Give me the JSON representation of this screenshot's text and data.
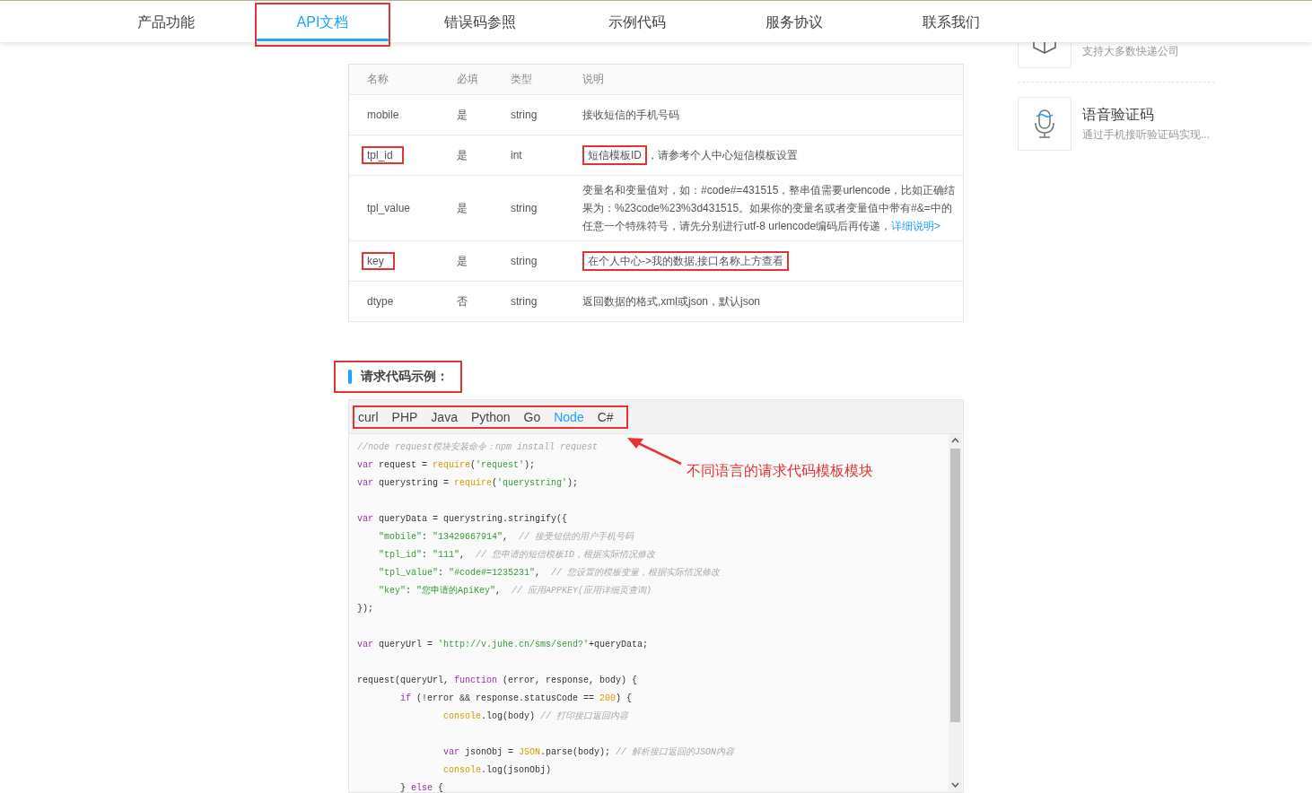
{
  "nav": [
    {
      "label": "产品功能",
      "selected": false,
      "marked": false
    },
    {
      "label": "API文档",
      "selected": true,
      "marked": true
    },
    {
      "label": "错误码参照",
      "selected": false,
      "marked": false
    },
    {
      "label": "示例代码",
      "selected": false,
      "marked": false
    },
    {
      "label": "服务协议",
      "selected": false,
      "marked": false
    },
    {
      "label": "联系我们",
      "selected": false,
      "marked": false
    }
  ],
  "params_table": {
    "columns": [
      "名称",
      "必填",
      "类型",
      "说明"
    ],
    "rows": [
      {
        "name": {
          "text": "mobile",
          "marked": false
        },
        "required": "是",
        "type": "string",
        "description": [
          {
            "kind": "text",
            "text": "接收短信的手机号码"
          }
        ]
      },
      {
        "name": {
          "text": "tpl_id",
          "marked": true
        },
        "required": "是",
        "type": "int",
        "description": [
          {
            "kind": "text",
            "text": "短信模板ID",
            "marked": true
          },
          {
            "kind": "text",
            "text": "，请参考个人中心短信模板设置"
          }
        ]
      },
      {
        "name": {
          "text": "tpl_value",
          "marked": false
        },
        "required": "是",
        "type": "string",
        "description": [
          {
            "kind": "text",
            "text": "变量名和变量值对，如：#code#=431515，整串值需要urlencode，比如正确结果为：%23code%23%3d431515。如果你的变量名或者变量值中带有#&=中的任意一个特殊符号，请先分别进行utf-8 urlencode编码后再传递，"
          },
          {
            "kind": "link",
            "text": "详细说明>"
          }
        ]
      },
      {
        "name": {
          "text": "key",
          "marked": true
        },
        "required": "是",
        "type": "string",
        "description": [
          {
            "kind": "text",
            "text": "在个人中心->我的数据,接口名称上方查看",
            "marked": true
          }
        ]
      },
      {
        "name": {
          "text": "dtype",
          "marked": false
        },
        "required": "否",
        "type": "string",
        "description": [
          {
            "kind": "text",
            "text": "返回数据的格式,xml或json，默认json"
          }
        ]
      }
    ]
  },
  "code_section": {
    "heading": "请求代码示例：",
    "heading_marked": true,
    "tabs_marked": true,
    "tabs": [
      {
        "label": "curl",
        "selected": false
      },
      {
        "label": "PHP",
        "selected": false
      },
      {
        "label": "Java",
        "selected": false
      },
      {
        "label": "Python",
        "selected": false
      },
      {
        "label": "Go",
        "selected": false
      },
      {
        "label": "Node",
        "selected": true
      },
      {
        "label": "C#",
        "selected": false
      }
    ],
    "annotation": "不同语言的请求代码模板模块",
    "lines": [
      {
        "kind": "code",
        "tokens": [
          {
            "kind": "comment",
            "text": "//node request模块安装命令：npm install request"
          }
        ]
      },
      {
        "kind": "code",
        "tokens": [
          {
            "kind": "keyword",
            "text": "var"
          },
          {
            "kind": "plain",
            "text": " request = "
          },
          {
            "kind": "builtin",
            "text": "require"
          },
          {
            "kind": "plain",
            "text": "("
          },
          {
            "kind": "string",
            "text": "'request'"
          },
          {
            "kind": "plain",
            "text": ");"
          }
        ]
      },
      {
        "kind": "code",
        "tokens": [
          {
            "kind": "keyword",
            "text": "var"
          },
          {
            "kind": "plain",
            "text": " querystring = "
          },
          {
            "kind": "builtin",
            "text": "require"
          },
          {
            "kind": "plain",
            "text": "("
          },
          {
            "kind": "string",
            "text": "'querystring'"
          },
          {
            "kind": "plain",
            "text": ");"
          }
        ]
      },
      {
        "kind": "blank"
      },
      {
        "kind": "code",
        "tokens": [
          {
            "kind": "keyword",
            "text": "var"
          },
          {
            "kind": "plain",
            "text": " queryData = querystring.stringify({"
          }
        ]
      },
      {
        "kind": "code",
        "tokens": [
          {
            "kind": "string",
            "text": "    \"mobile\""
          },
          {
            "kind": "plain",
            "text": ": "
          },
          {
            "kind": "string",
            "text": "\"13429667914\""
          },
          {
            "kind": "plain",
            "text": ",  "
          },
          {
            "kind": "comment",
            "text": "// 接受短信的用户手机号码"
          }
        ]
      },
      {
        "kind": "code",
        "tokens": [
          {
            "kind": "string",
            "text": "    \"tpl_id\""
          },
          {
            "kind": "plain",
            "text": ": "
          },
          {
            "kind": "string",
            "text": "\"111\""
          },
          {
            "kind": "plain",
            "text": ",  "
          },
          {
            "kind": "comment",
            "text": "// 您申请的短信模板ID，根据实际情况修改"
          }
        ]
      },
      {
        "kind": "code",
        "tokens": [
          {
            "kind": "string",
            "text": "    \"tpl_value\""
          },
          {
            "kind": "plain",
            "text": ": "
          },
          {
            "kind": "string",
            "text": "\"#code#=1235231\""
          },
          {
            "kind": "plain",
            "text": ",  "
          },
          {
            "kind": "comment",
            "text": "// 您设置的模板变量，根据实际情况修改"
          }
        ]
      },
      {
        "kind": "code",
        "tokens": [
          {
            "kind": "string",
            "text": "    \"key\""
          },
          {
            "kind": "plain",
            "text": ": "
          },
          {
            "kind": "string",
            "text": "\"您申请的ApiKey\""
          },
          {
            "kind": "plain",
            "text": ",  "
          },
          {
            "kind": "comment",
            "text": "// 应用APPKEY(应用详细页查询)"
          }
        ]
      },
      {
        "kind": "code",
        "tokens": [
          {
            "kind": "plain",
            "text": "});"
          }
        ]
      },
      {
        "kind": "blank"
      },
      {
        "kind": "code",
        "tokens": [
          {
            "kind": "keyword",
            "text": "var"
          },
          {
            "kind": "plain",
            "text": " queryUrl = "
          },
          {
            "kind": "string",
            "text": "'http://v.juhe.cn/sms/send?'"
          },
          {
            "kind": "plain",
            "text": "+queryData;"
          }
        ]
      },
      {
        "kind": "blank"
      },
      {
        "kind": "code",
        "tokens": [
          {
            "kind": "plain",
            "text": "request(queryUrl, "
          },
          {
            "kind": "keyword",
            "text": "function"
          },
          {
            "kind": "plain",
            "text": " (error, response, body) {"
          }
        ]
      },
      {
        "kind": "code",
        "tokens": [
          {
            "kind": "keyword",
            "text": "        if"
          },
          {
            "kind": "plain",
            "text": " (!error && response.statusCode == "
          },
          {
            "kind": "number",
            "text": "200"
          },
          {
            "kind": "plain",
            "text": ") {"
          }
        ]
      },
      {
        "kind": "code",
        "tokens": [
          {
            "kind": "builtin",
            "text": "                console"
          },
          {
            "kind": "plain",
            "text": ".log(body) "
          },
          {
            "kind": "comment",
            "text": "// 打印接口返回内容"
          }
        ]
      },
      {
        "kind": "blank"
      },
      {
        "kind": "code",
        "tokens": [
          {
            "kind": "keyword",
            "text": "                var"
          },
          {
            "kind": "plain",
            "text": " jsonObj = "
          },
          {
            "kind": "builtin",
            "text": "JSON"
          },
          {
            "kind": "plain",
            "text": ".parse(body); "
          },
          {
            "kind": "comment",
            "text": "// 解析接口返回的JSON内容"
          }
        ]
      },
      {
        "kind": "code",
        "tokens": [
          {
            "kind": "builtin",
            "text": "                console"
          },
          {
            "kind": "plain",
            "text": ".log(jsonObj)"
          }
        ]
      },
      {
        "kind": "code",
        "tokens": [
          {
            "kind": "plain",
            "text": "        } "
          },
          {
            "kind": "keyword",
            "text": "else"
          },
          {
            "kind": "plain",
            "text": " {"
          }
        ]
      }
    ]
  },
  "sidebar": [
    {
      "kind": "box",
      "subtitle": "支持大多数快递公司"
    },
    {
      "kind": "mic",
      "title": "语音验证码",
      "subtitle": "通过手机接听验证码实现..."
    }
  ]
}
